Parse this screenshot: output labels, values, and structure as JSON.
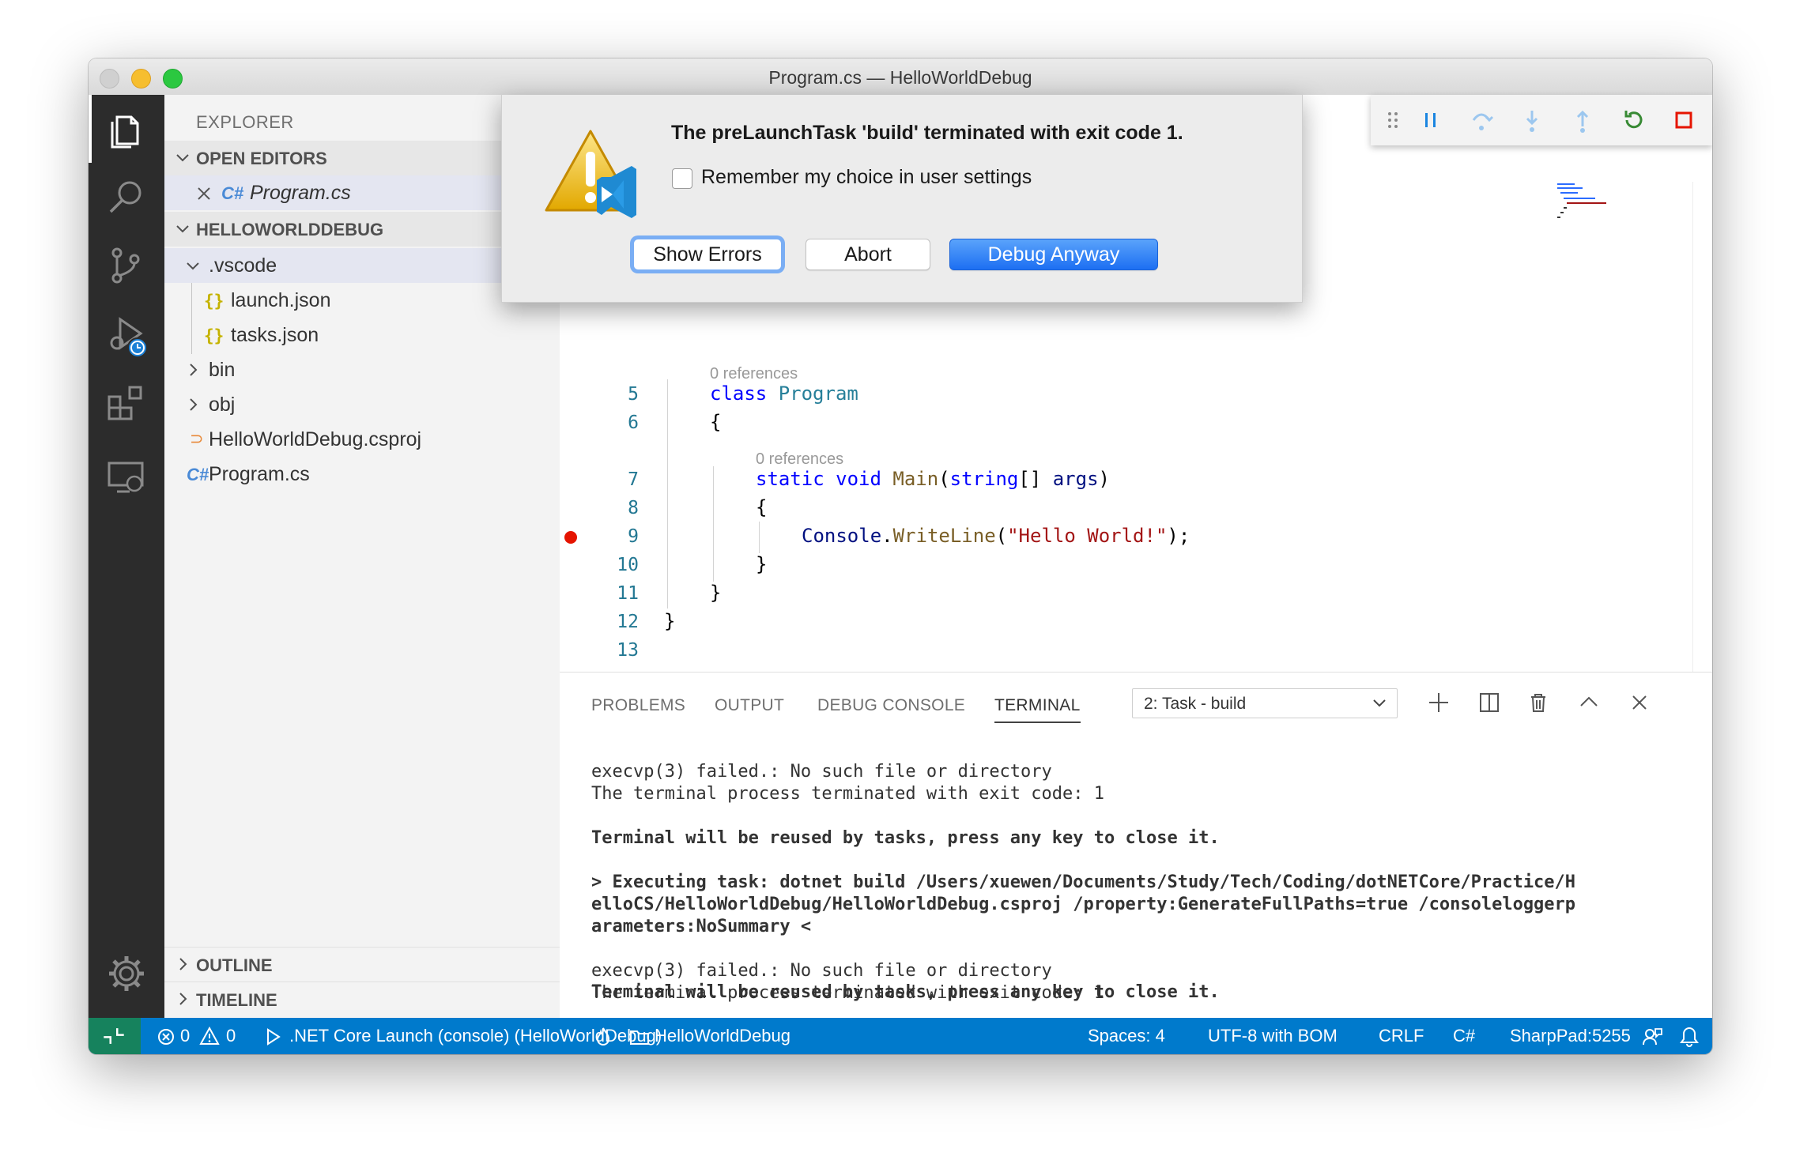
{
  "window": {
    "title": "Program.cs — HelloWorldDebug"
  },
  "sidebar": {
    "title": "EXPLORER",
    "open_editors": {
      "label": "OPEN EDITORS",
      "items": [
        {
          "icon": "C#",
          "name": "Program.cs"
        }
      ]
    },
    "project": {
      "label": "HELLOWORLDDEBUG",
      "tree": {
        "vscode": ".vscode",
        "launch": "launch.json",
        "tasks": "tasks.json",
        "bin": "bin",
        "obj": "obj",
        "csproj": "HelloWorldDebug.csproj",
        "program": "Program.cs"
      },
      "json_icon": "{}",
      "cs_icon": "C#",
      "rss_icon": "⊃"
    },
    "outline": "OUTLINE",
    "timeline": "TIMELINE"
  },
  "editor": {
    "refs": {
      "class_refs": "0 references",
      "main_refs": "0 references"
    },
    "lines": {
      "l5": "5",
      "l6": "6",
      "l7": "7",
      "l8": "8",
      "l9": "9",
      "l10": "10",
      "l11": "11",
      "l12": "12",
      "l13": "13"
    },
    "code": {
      "class_kw": "class",
      "class_name": "Program",
      "open_brace": "{",
      "static_kw": "static",
      "void_kw": "void",
      "main_fn": "Main",
      "paren_open": "(",
      "string_kw": "string",
      "brackets": "[]",
      "args": "args",
      "paren_close": ")",
      "console": "Console",
      "dot": ".",
      "writeline": "WriteLine",
      "str": "\"Hello World!\"",
      "end_call": ");",
      "close_brace": "}"
    }
  },
  "dialog": {
    "message": "The preLaunchTask 'build' terminated with exit code 1.",
    "checkbox_label": "Remember my choice in user settings",
    "buttons": {
      "show_errors": "Show Errors",
      "abort": "Abort",
      "debug_anyway": "Debug Anyway"
    }
  },
  "panel": {
    "tabs": {
      "problems": "PROBLEMS",
      "output": "OUTPUT",
      "debug_console": "DEBUG CONSOLE",
      "terminal": "TERMINAL"
    },
    "terminal_select": "2: Task - build",
    "terminal_lines": {
      "t1": "execvp(3) failed.: No such file or directory",
      "t2": "The terminal process terminated with exit code: 1",
      "t3": "Terminal will be reused by tasks, press any key to close it.",
      "t4": "> Executing task: dotnet build /Users/xuewen/Documents/Study/Tech/Coding/dotNETCore/Practice/H",
      "t5": "elloCS/HelloWorldDebug/HelloWorldDebug.csproj /property:GenerateFullPaths=true /consoleloggerp",
      "t6": "arameters:NoSummary <",
      "t7": "execvp(3) failed.: No such file or directory",
      "t8": "The terminal process terminated with exit code: 1",
      "t9": "Terminal will be reused by tasks, press any key to close it."
    }
  },
  "statusbar": {
    "errors": "0",
    "warnings": "0",
    "launch": ".NET Core Launch (console) (HelloWorldDebug)",
    "folder": "HelloWorldDebug",
    "spaces": "Spaces: 4",
    "encoding": "UTF-8 with BOM",
    "eol": "CRLF",
    "language": "C#",
    "sharppad": "SharpPad:5255"
  },
  "colors": {
    "statusbar": "#007acc",
    "remote": "#16825d",
    "activitybar": "#2c2c2c",
    "breakpoint": "#e51400",
    "primary_button": "#1d6ff2"
  }
}
